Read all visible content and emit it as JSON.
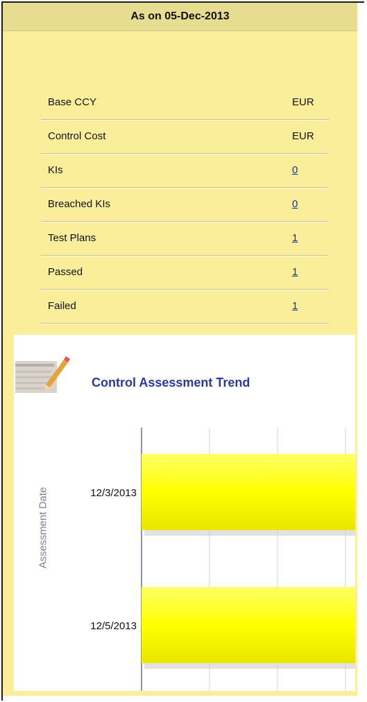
{
  "header": {
    "title": "As on 05-Dec-2013"
  },
  "summary": {
    "rows": [
      {
        "label": "Base CCY",
        "value": "EUR",
        "link": false
      },
      {
        "label": "Control Cost",
        "value": "EUR",
        "link": false
      },
      {
        "label": "KIs",
        "value": "0",
        "link": true
      },
      {
        "label": "Breached KIs",
        "value": "0",
        "link": true
      },
      {
        "label": "Test Plans",
        "value": "1",
        "link": true
      },
      {
        "label": "Passed",
        "value": "1",
        "link": true
      },
      {
        "label": "Failed",
        "value": "1",
        "link": true
      }
    ]
  },
  "colors": {
    "panel": "#fbee9a",
    "bar": "#ffff00",
    "title": "#2b3a9a"
  },
  "chart_data": {
    "type": "bar",
    "orientation": "horizontal",
    "title": "Control Assessment Trend",
    "ylabel": "Assessment Date",
    "categories": [
      "12/3/2013",
      "12/5/2013"
    ],
    "grid": true
  }
}
